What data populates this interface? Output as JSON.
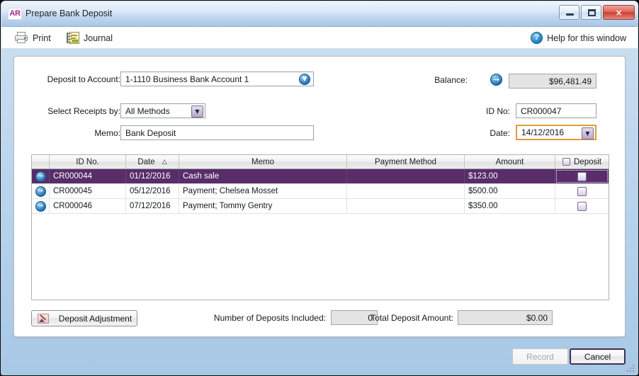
{
  "window": {
    "icon_label": "AR",
    "title": "Prepare Bank Deposit",
    "minimize_label": "Minimize",
    "maximize_label": "Maximize",
    "close_label": "×"
  },
  "toolbar": {
    "print_label": "Print",
    "journal_label": "Journal",
    "help_label": "Help for this window",
    "help_glyph": "?"
  },
  "form": {
    "deposit_to_account_label": "Deposit to Account:",
    "deposit_to_account_value": "1-1110 Business Bank Account 1",
    "select_receipts_by_label": "Select Receipts by:",
    "select_receipts_by_value": "All Methods",
    "memo_label": "Memo:",
    "memo_value": "Bank Deposit",
    "balance_label": "Balance:",
    "balance_value": "$96,481.49",
    "id_no_label": "ID No:",
    "id_no_value": "CR000047",
    "date_label": "Date:",
    "date_value": "14/12/2016",
    "arrow_glyph": "→",
    "chevron_glyph": "▼"
  },
  "grid": {
    "columns": [
      {
        "key": "marker",
        "label": ""
      },
      {
        "key": "id_no",
        "label": "ID No."
      },
      {
        "key": "date",
        "label": "Date",
        "sort": "△"
      },
      {
        "key": "memo",
        "label": "Memo"
      },
      {
        "key": "payment_method",
        "label": "Payment Method"
      },
      {
        "key": "amount",
        "label": "Amount"
      },
      {
        "key": "deposit",
        "label": "Deposit"
      }
    ],
    "rows": [
      {
        "id_no": "CR000044",
        "date": "01/12/2016",
        "memo": "Cash sale",
        "payment_method": "",
        "amount": "$123.00",
        "deposit_checked": false,
        "selected": true
      },
      {
        "id_no": "CR000045",
        "date": "05/12/2016",
        "memo": "Payment; Chelsea Mosset",
        "payment_method": "",
        "amount": "$500.00",
        "deposit_checked": false,
        "selected": false
      },
      {
        "id_no": "CR000046",
        "date": "07/12/2016",
        "memo": "Payment; Tommy Gentry",
        "payment_method": "",
        "amount": "$350.00",
        "deposit_checked": false,
        "selected": false
      }
    ]
  },
  "footer": {
    "deposit_adjustment_label": "Deposit Adjustment",
    "number_of_deposits_label": "Number of Deposits Included:",
    "number_of_deposits_value": "0",
    "total_deposit_amount_label": "Total Deposit Amount:",
    "total_deposit_amount_value": "$0.00",
    "record_label": "Record",
    "cancel_label": "Cancel"
  },
  "colors": {
    "selection": "#582d69",
    "accent_icon": "#a3219b",
    "date_focus": "#e09c38"
  }
}
